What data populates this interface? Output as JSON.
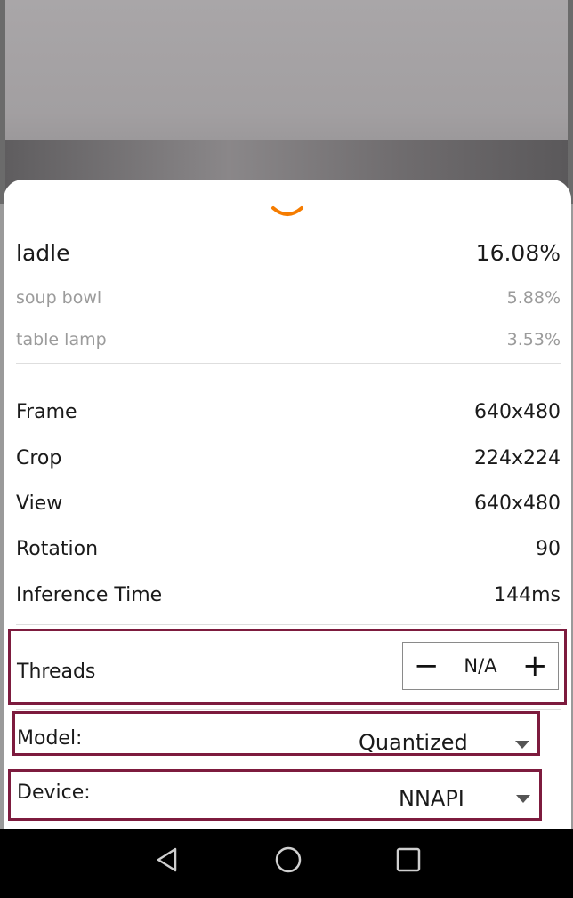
{
  "results": {
    "top": {
      "label": "ladle",
      "score": "16.08%"
    },
    "others": [
      {
        "label": "soup bowl",
        "score": "5.88%"
      },
      {
        "label": "table lamp",
        "score": "3.53%"
      }
    ]
  },
  "info": [
    {
      "label": "Frame",
      "value": "640x480"
    },
    {
      "label": "Crop",
      "value": "224x224"
    },
    {
      "label": "View",
      "value": "640x480"
    },
    {
      "label": "Rotation",
      "value": "90"
    },
    {
      "label": "Inference Time",
      "value": "144ms"
    }
  ],
  "threads": {
    "label": "Threads",
    "value": "N/A",
    "minus": "−",
    "plus": "+"
  },
  "model": {
    "label": "Model:",
    "value": "Quantized"
  },
  "device": {
    "label": "Device:",
    "value": "NNAPI"
  },
  "colors": {
    "accent": "#f57c00",
    "highlight": "#7d1b3e"
  },
  "icons": [
    "chevron-down-icon",
    "back-icon",
    "home-icon",
    "recents-icon",
    "dropdown-arrow-icon"
  ]
}
